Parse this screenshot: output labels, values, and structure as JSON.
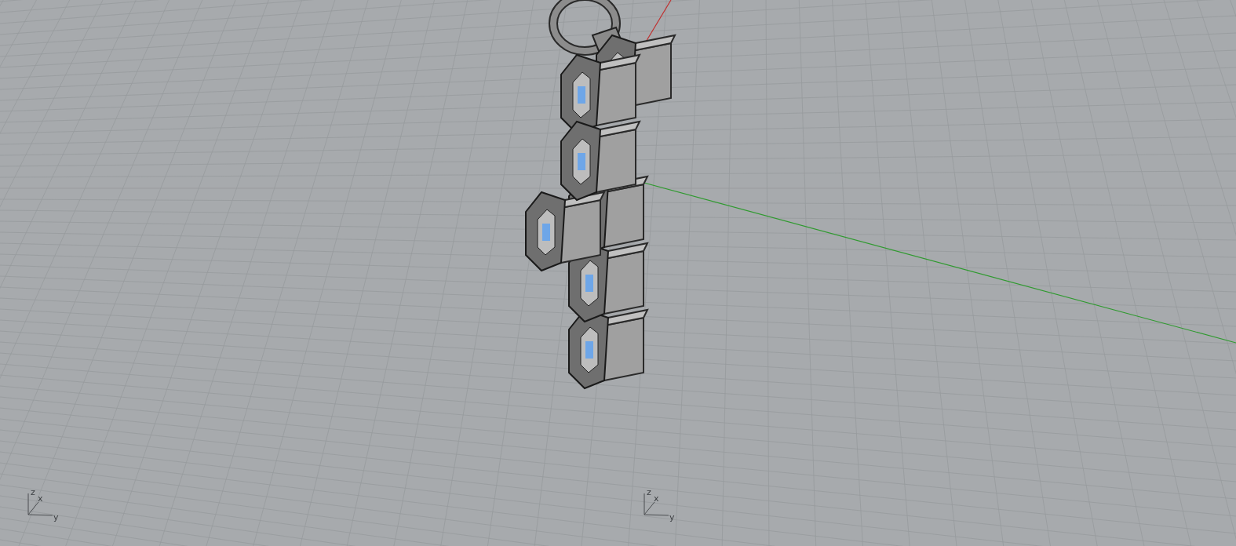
{
  "viewport": {
    "triads": [
      {
        "z": "z",
        "x": "x",
        "y": "y"
      },
      {
        "z": "z",
        "x": "x",
        "y": "y"
      }
    ]
  }
}
